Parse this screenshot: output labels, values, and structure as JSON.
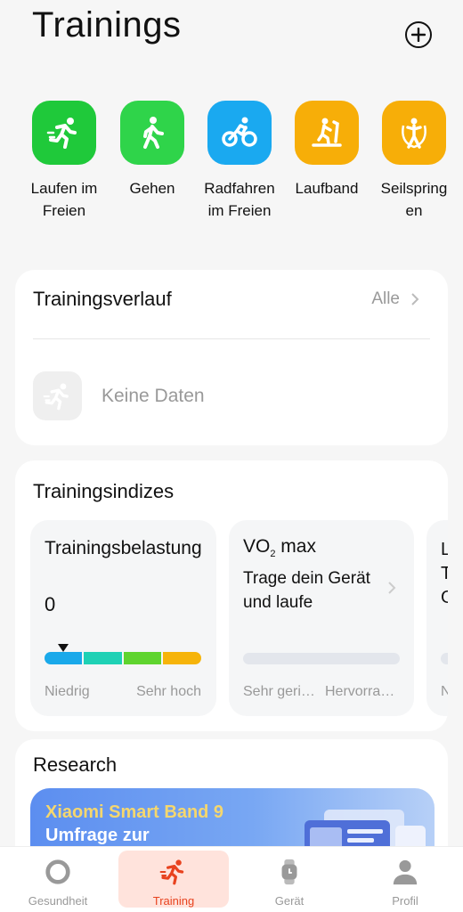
{
  "header": {
    "title": "Trainings"
  },
  "shortcuts": [
    {
      "label": "Laufen im Freien",
      "icon": "running-icon",
      "color": "#1fc93a"
    },
    {
      "label": "Gehen",
      "icon": "walking-icon",
      "color": "#2fd44a"
    },
    {
      "label": "Radfahren im Freien",
      "icon": "cycling-icon",
      "color": "#1aa9f0"
    },
    {
      "label": "Laufband",
      "icon": "treadmill-icon",
      "color": "#f7ae08"
    },
    {
      "label": "Seilspringen",
      "icon": "jump-rope-icon",
      "color": "#f7ae08"
    }
  ],
  "history": {
    "title": "Trainingsverlauf",
    "all_label": "Alle",
    "empty_text": "Keine Daten"
  },
  "indices": {
    "title": "Trainingsindizes",
    "load": {
      "title": "Trainingsbelastung",
      "value": "0",
      "low_label": "Niedrig",
      "high_label": "Sehr hoch",
      "colors": [
        "#1aa9ea",
        "#1fd1b5",
        "#5fd42f",
        "#f6b40a"
      ]
    },
    "vo2": {
      "title_main": "VO",
      "title_sub": "2",
      "title_rest": " max",
      "description": "Trage dein Gerät und laufe",
      "low_label": "Sehr geri…",
      "high_label": "Hervorra…"
    },
    "third": {
      "letters": "L\nT\nG",
      "low_label": "N"
    }
  },
  "research": {
    "title": "Research",
    "banner_line1": "Xiaomi Smart Band 9",
    "banner_line2": "Umfrage zur"
  },
  "tabbar": [
    {
      "label": "Gesundheit",
      "icon": "health-ring-icon",
      "active": false
    },
    {
      "label": "Training",
      "icon": "running-icon",
      "active": true
    },
    {
      "label": "Gerät",
      "icon": "watch-icon",
      "active": false
    },
    {
      "label": "Profil",
      "icon": "person-icon",
      "active": false
    }
  ]
}
